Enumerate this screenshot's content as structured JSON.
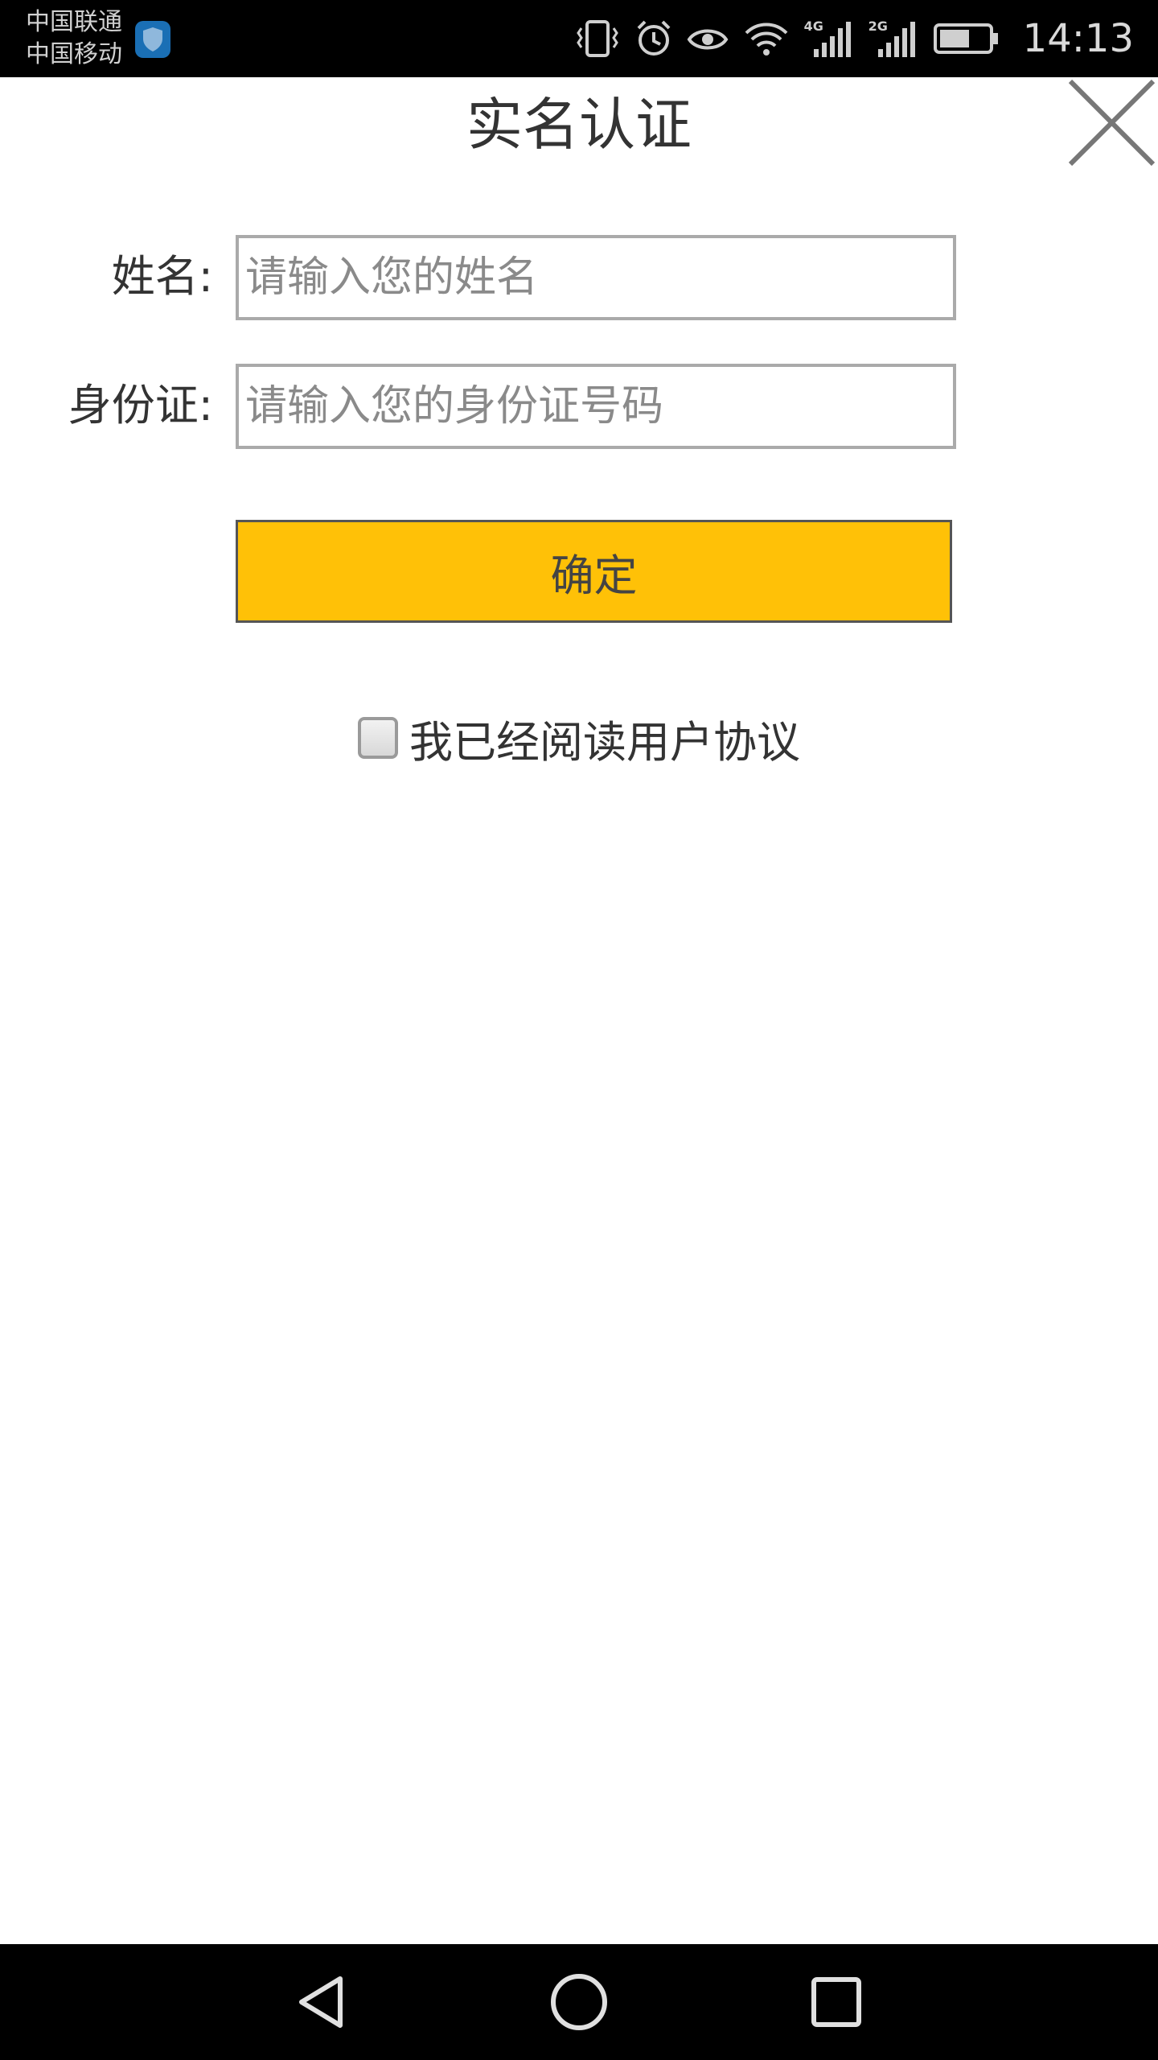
{
  "status_bar": {
    "carrier_1": "中国联通",
    "carrier_2": "中国移动",
    "time": "14:13",
    "net_1": "4G",
    "net_2": "2G"
  },
  "dialog": {
    "title": "实名认证",
    "name_label": "姓名:",
    "name_placeholder": "请输入您的姓名",
    "name_value": "",
    "id_label": "身份证:",
    "id_placeholder": "请输入您的身份证号码",
    "id_value": "",
    "confirm_label": "确定",
    "agreement_label": "我已经阅读用户协议",
    "agreement_checked": false
  },
  "icons": {
    "close": "close-icon",
    "back": "back-triangle-icon",
    "home": "home-circle-icon",
    "recents": "recents-square-icon"
  },
  "colors": {
    "accent_button": "#ffc107",
    "status_bar_bg": "#000000",
    "nav_bar_bg": "#000000"
  }
}
